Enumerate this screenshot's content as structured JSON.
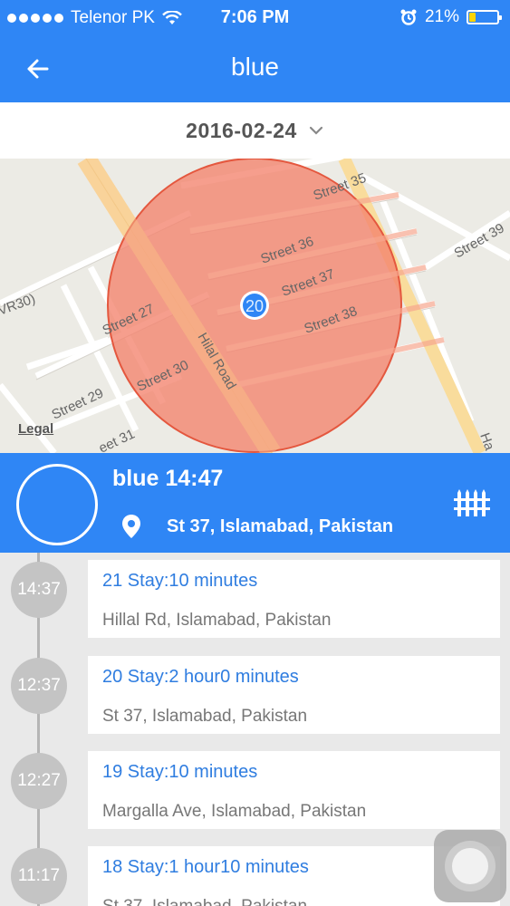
{
  "status_bar": {
    "carrier": "Telenor PK",
    "time": "7:06 PM",
    "battery": "21%"
  },
  "nav": {
    "title": "blue",
    "back_icon": "arrow-left-icon"
  },
  "date_selector": {
    "value": "2016-02-24",
    "icon": "chevron-down-icon"
  },
  "map": {
    "legal": "Legal",
    "marker_label": "20",
    "streets": {
      "s35": "Street 35",
      "s36": "Street 36",
      "s37": "Street 37",
      "s38": "Street 38",
      "s39": "Street 39",
      "s27": "Street 27",
      "s29": "Street 29",
      "s30": "Street 30",
      "s31": "eet 31",
      "hilal": "Hilal Road",
      "vr30": "VR30)",
      "ha": "Ha"
    },
    "colors": {
      "geofence_fill": "#f4836d",
      "geofence_stroke": "#e4573e",
      "road_highlight": "#f9dc9c"
    }
  },
  "info_panel": {
    "title": "blue 14:47",
    "address": "St 37, Islamabad, Pakistan",
    "pin_icon": "location-pin-icon",
    "fence_icon": "fence-icon"
  },
  "timeline": [
    {
      "time": "14:37",
      "title": "21 Stay:10 minutes",
      "address": "Hillal Rd, Islamabad, Pakistan"
    },
    {
      "time": "12:37",
      "title": "20 Stay:2 hour0 minutes",
      "address": "St 37, Islamabad, Pakistan"
    },
    {
      "time": "12:27",
      "title": "19 Stay:10 minutes",
      "address": "Margalla Ave, Islamabad, Pakistan"
    },
    {
      "time": "11:17",
      "title": "18 Stay:1 hour10 minutes",
      "address": "St 37, Islamabad, Pakistan"
    }
  ],
  "theme": {
    "primary": "#2f86f5",
    "link": "#2f7de0"
  }
}
